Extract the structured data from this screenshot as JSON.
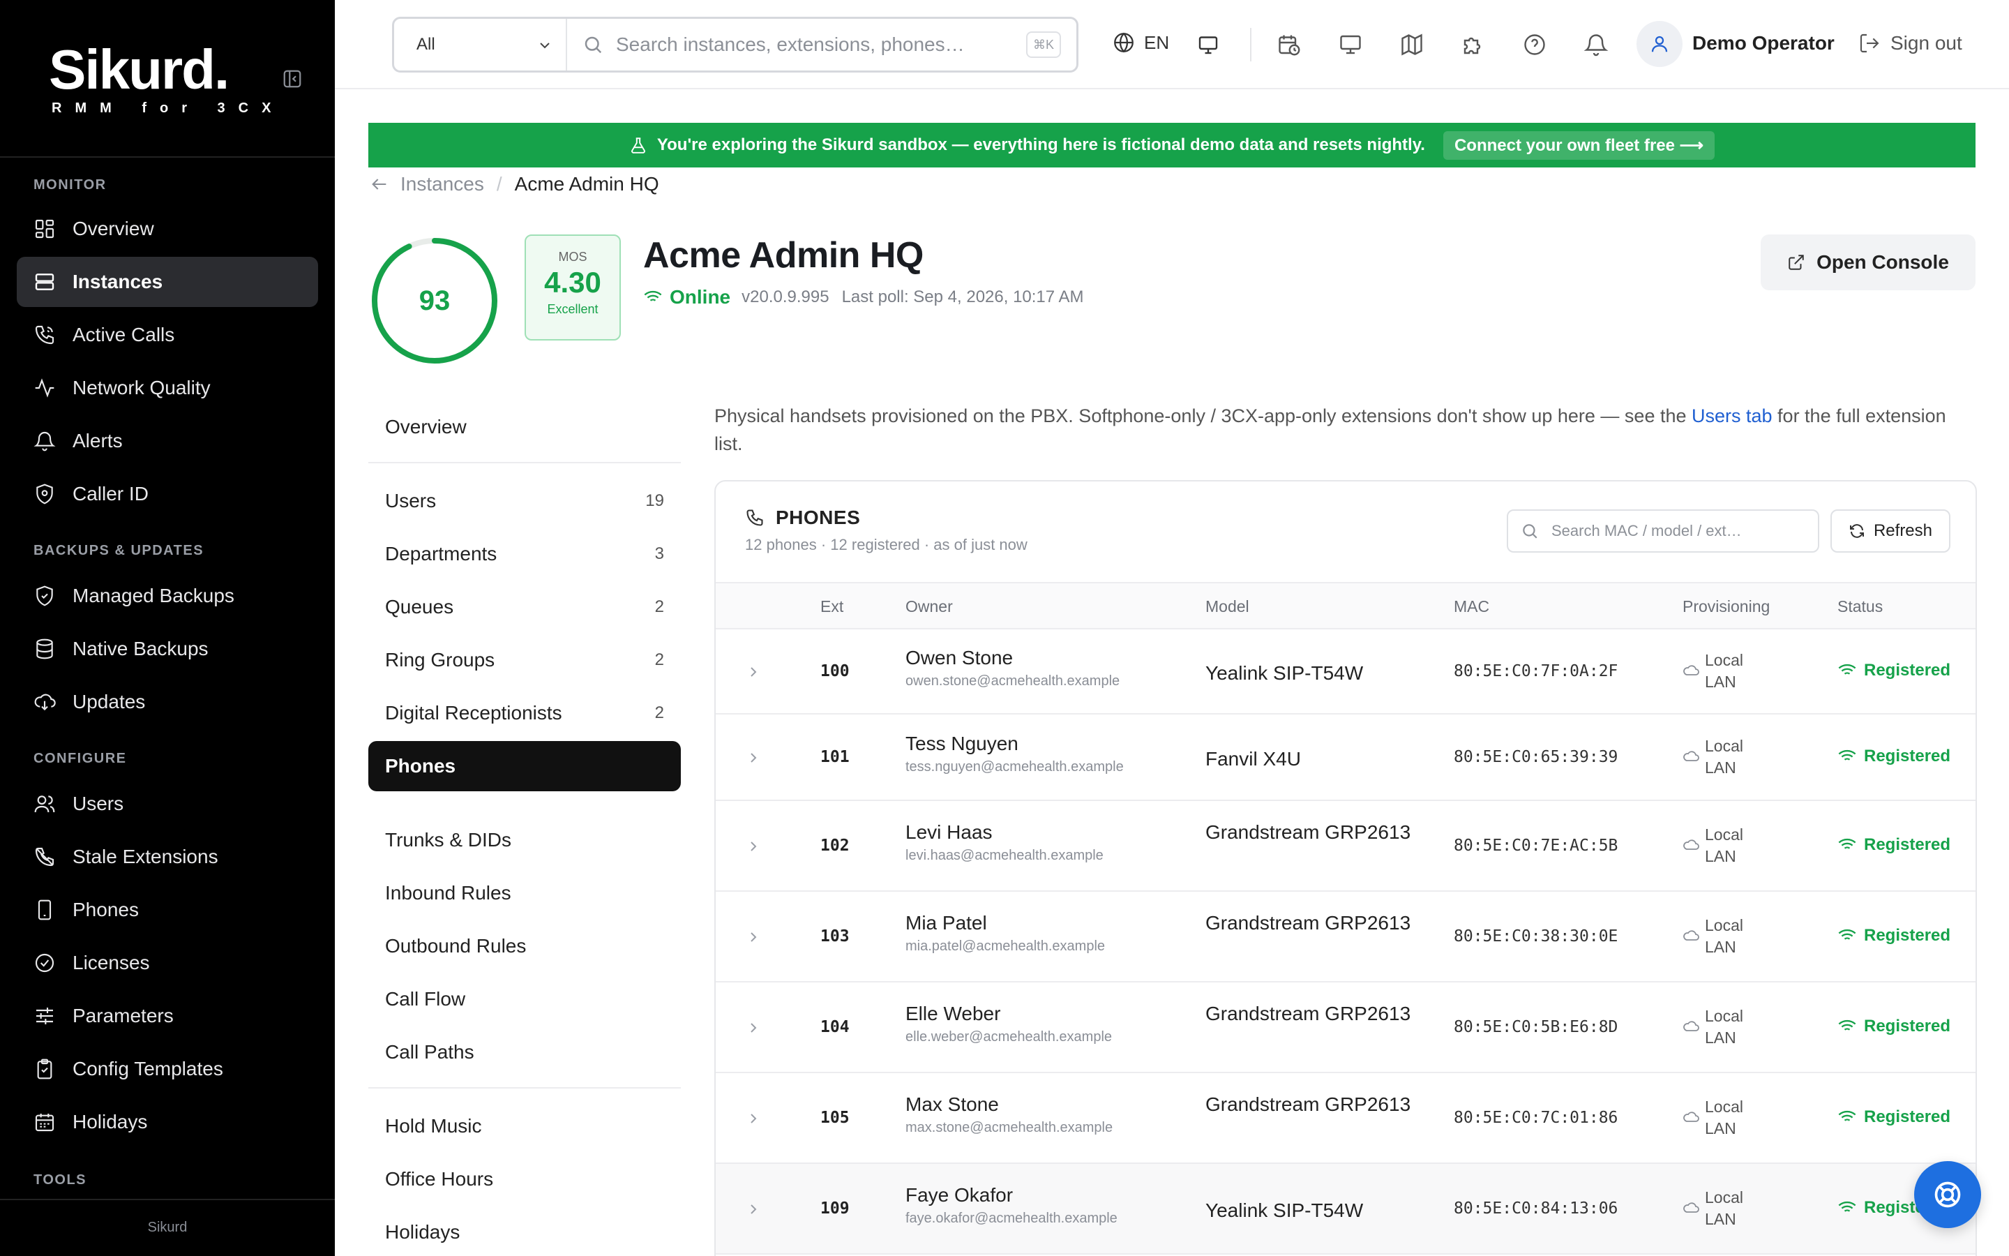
{
  "brand": {
    "name": "Sikurd.",
    "subtitle": "RMM for 3CX",
    "footer": "Sikurd"
  },
  "sidebar": {
    "sections": [
      {
        "title": "MONITOR",
        "items": [
          {
            "label": "Overview",
            "icon": "grid-icon"
          },
          {
            "label": "Instances",
            "icon": "server-icon",
            "active": true
          },
          {
            "label": "Active Calls",
            "icon": "phone-call-icon"
          },
          {
            "label": "Network Quality",
            "icon": "activity-icon"
          },
          {
            "label": "Alerts",
            "icon": "bell-icon"
          },
          {
            "label": "Caller ID",
            "icon": "shield-icon"
          }
        ]
      },
      {
        "title": "BACKUPS & UPDATES",
        "items": [
          {
            "label": "Managed Backups",
            "icon": "shield-check-icon"
          },
          {
            "label": "Native Backups",
            "icon": "database-icon"
          },
          {
            "label": "Updates",
            "icon": "cloud-download-icon"
          }
        ]
      },
      {
        "title": "CONFIGURE",
        "items": [
          {
            "label": "Users",
            "icon": "users-icon"
          },
          {
            "label": "Stale Extensions",
            "icon": "phone-off-icon"
          },
          {
            "label": "Phones",
            "icon": "smartphone-icon"
          },
          {
            "label": "Licenses",
            "icon": "badge-check-icon"
          },
          {
            "label": "Parameters",
            "icon": "sliders-icon"
          },
          {
            "label": "Config Templates",
            "icon": "clipboard-icon"
          },
          {
            "label": "Holidays",
            "icon": "calendar-icon"
          }
        ]
      },
      {
        "title": "TOOLS",
        "items": []
      }
    ]
  },
  "topbar": {
    "scope": "All",
    "search_placeholder": "Search instances, extensions, phones…",
    "shortcut": "⌘K",
    "language": "EN",
    "user": "Demo Operator",
    "signout": "Sign out"
  },
  "banner": {
    "text": "You're exploring the Sikurd sandbox — everything here is fictional demo data and resets nightly.",
    "cta": "Connect your own fleet free ⟶"
  },
  "breadcrumb": {
    "parent": "Instances",
    "sep": "/",
    "current": "Acme Admin HQ"
  },
  "instance": {
    "score": "93",
    "score_fraction": 0.93,
    "mos_label": "MOS",
    "mos_value": "4.30",
    "mos_quality": "Excellent",
    "title": "Acme Admin HQ",
    "status": "Online",
    "version": "v20.0.9.995",
    "last_poll": "Last poll: Sep 4, 2026, 10:17 AM",
    "console_label": "Open Console"
  },
  "subnav": {
    "overview": "Overview",
    "group1": [
      {
        "label": "Users",
        "count": "19"
      },
      {
        "label": "Departments",
        "count": "3"
      },
      {
        "label": "Queues",
        "count": "2"
      },
      {
        "label": "Ring Groups",
        "count": "2"
      },
      {
        "label": "Digital Receptionists",
        "count": "2"
      },
      {
        "label": "Phones",
        "count": "",
        "active": true
      }
    ],
    "group2": [
      "Trunks & DIDs",
      "Inbound Rules",
      "Outbound Rules",
      "Call Flow",
      "Call Paths"
    ],
    "group3": [
      "Hold Music",
      "Office Hours",
      "Holidays"
    ]
  },
  "intro": {
    "before": "Physical handsets provisioned on the PBX. Softphone-only / 3CX-app-only extensions don't show up here — see the ",
    "link": "Users tab",
    "after": " for the full extension list."
  },
  "phones": {
    "title": "PHONES",
    "subtitle": "12 phones · 12 registered · as of just now",
    "search_placeholder": "Search MAC / model / ext…",
    "refresh": "Refresh",
    "columns": [
      "Ext",
      "Owner",
      "Model",
      "MAC",
      "Provisioning",
      "Status"
    ],
    "rows": [
      {
        "ext": "100",
        "name": "Owen Stone",
        "email": "owen.stone@acmehealth.example",
        "model": "Yealink SIP-T54W",
        "mac": "80:5E:C0:7F:0A:2F",
        "prov": "Local LAN",
        "status": "Registered"
      },
      {
        "ext": "101",
        "name": "Tess Nguyen",
        "email": "tess.nguyen@acmehealth.example",
        "model": "Fanvil X4U",
        "mac": "80:5E:C0:65:39:39",
        "prov": "Local LAN",
        "status": "Registered"
      },
      {
        "ext": "102",
        "name": "Levi Haas",
        "email": "levi.haas@acmehealth.example",
        "model": "Grandstream GRP2613",
        "mac": "80:5E:C0:7E:AC:5B",
        "prov": "Local LAN",
        "status": "Registered"
      },
      {
        "ext": "103",
        "name": "Mia Patel",
        "email": "mia.patel@acmehealth.example",
        "model": "Grandstream GRP2613",
        "mac": "80:5E:C0:38:30:0E",
        "prov": "Local LAN",
        "status": "Registered"
      },
      {
        "ext": "104",
        "name": "Elle Weber",
        "email": "elle.weber@acmehealth.example",
        "model": "Grandstream GRP2613",
        "mac": "80:5E:C0:5B:E6:8D",
        "prov": "Local LAN",
        "status": "Registered"
      },
      {
        "ext": "105",
        "name": "Max Stone",
        "email": "max.stone@acmehealth.example",
        "model": "Grandstream GRP2613",
        "mac": "80:5E:C0:7C:01:86",
        "prov": "Local LAN",
        "status": "Registered"
      },
      {
        "ext": "109",
        "name": "Faye Okafor",
        "email": "faye.okafor@acmehealth.example",
        "model": "Yealink SIP-T54W",
        "mac": "80:5E:C0:84:13:06",
        "prov": "Local LAN",
        "status": "Registered"
      }
    ]
  },
  "colors": {
    "accent": "#16a24a",
    "link": "#1f5fd1",
    "sidebar": "#000000",
    "fab": "#1e6fe0"
  }
}
